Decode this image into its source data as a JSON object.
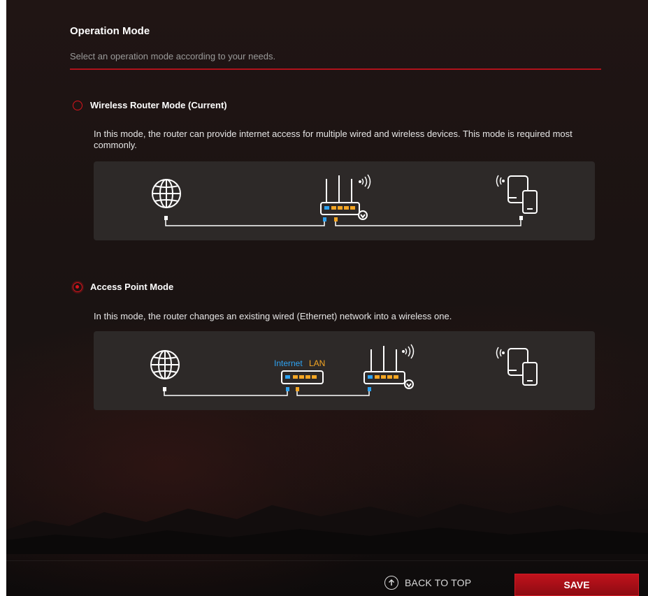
{
  "header": {
    "title": "Operation Mode",
    "subtitle": "Select an operation mode according to your needs."
  },
  "modes": [
    {
      "label": "Wireless Router Mode (Current)",
      "selected": false,
      "description": "In this mode, the router can provide internet access for multiple wired and wireless devices. This mode is required most commonly."
    },
    {
      "label": "Access Point Mode",
      "selected": true,
      "description": "In this mode, the router changes an existing wired (Ethernet) network into a wireless one.",
      "diagram_labels": {
        "internet": "Internet",
        "lan": "LAN"
      }
    }
  ],
  "footer": {
    "back_to_top": "BACK TO TOP",
    "save": "SAVE"
  },
  "icons": [
    "globe-icon",
    "router-icon",
    "wireless-signal-icon",
    "devices-icon",
    "switch-icon",
    "arrow-up-circle-icon"
  ],
  "colors": {
    "accent": "#d8141c",
    "internet_port": "#2ea3f2",
    "lan_port": "#f5a623",
    "panel": "#2d2928",
    "text": "#ffffff"
  }
}
